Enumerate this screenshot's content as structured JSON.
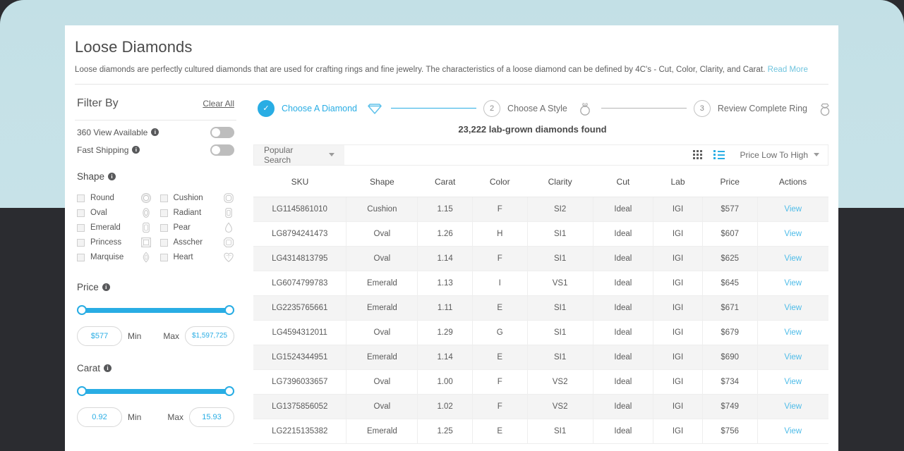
{
  "page": {
    "title": "Loose Diamonds",
    "description": "Loose diamonds are perfectly cultured diamonds that are used for crafting rings and fine jewelry. The characteristics of a loose diamond can be defined by 4C's - Cut, Color, Clarity, and Carat.",
    "read_more": "Read More"
  },
  "filter": {
    "title": "Filter By",
    "clear_all": "Clear All",
    "toggles": [
      {
        "label": "360 View Available",
        "info": "i",
        "state": "off"
      },
      {
        "label": "Fast Shipping",
        "info": "i",
        "state": "off"
      }
    ],
    "shape": {
      "title": "Shape",
      "info": "i",
      "items": [
        {
          "label": "Round",
          "icon": "round-shape-icon",
          "checked": false
        },
        {
          "label": "Cushion",
          "icon": "cushion-shape-icon",
          "checked": false
        },
        {
          "label": "Oval",
          "icon": "oval-shape-icon",
          "checked": false
        },
        {
          "label": "Radiant",
          "icon": "radiant-shape-icon",
          "checked": false
        },
        {
          "label": "Emerald",
          "icon": "emerald-shape-icon",
          "checked": false
        },
        {
          "label": "Pear",
          "icon": "pear-shape-icon",
          "checked": false
        },
        {
          "label": "Princess",
          "icon": "princess-shape-icon",
          "checked": false
        },
        {
          "label": "Asscher",
          "icon": "asscher-shape-icon",
          "checked": false
        },
        {
          "label": "Marquise",
          "icon": "marquise-shape-icon",
          "checked": false
        },
        {
          "label": "Heart",
          "icon": "heart-shape-icon",
          "checked": false
        }
      ]
    },
    "price": {
      "title": "Price",
      "info": "i",
      "min_value": "$577",
      "max_value": "$1,597,725",
      "min_label": "Min",
      "max_label": "Max"
    },
    "carat": {
      "title": "Carat",
      "info": "i",
      "min_value": "0.92",
      "max_value": "15.93",
      "min_label": "Min",
      "max_label": "Max"
    }
  },
  "stepper": {
    "steps": [
      {
        "num": "✓",
        "label": "Choose A Diamond",
        "icon": "diamond-icon",
        "state": "done"
      },
      {
        "num": "2",
        "label": "Choose A Style",
        "icon": "ring-icon",
        "state": "pending"
      },
      {
        "num": "3",
        "label": "Review Complete Ring",
        "icon": "ring-gem-icon",
        "state": "pending"
      }
    ]
  },
  "results": {
    "count_text": "23,222 lab-grown diamonds found"
  },
  "toolbar": {
    "popular_search": "Popular Search",
    "grid_view_icon": "grid-view-icon",
    "list_view_icon": "list-view-icon",
    "sort_value": "Price Low To High"
  },
  "table": {
    "columns": [
      "SKU",
      "Shape",
      "Carat",
      "Color",
      "Clarity",
      "Cut",
      "Lab",
      "Price",
      "Actions"
    ],
    "action_label": "View",
    "rows": [
      {
        "sku": "LG1145861010",
        "shape": "Cushion",
        "carat": "1.15",
        "color": "F",
        "clarity": "SI2",
        "cut": "Ideal",
        "lab": "IGI",
        "price": "$577",
        "action": "View"
      },
      {
        "sku": "LG8794241473",
        "shape": "Oval",
        "carat": "1.26",
        "color": "H",
        "clarity": "SI1",
        "cut": "Ideal",
        "lab": "IGI",
        "price": "$607",
        "action": "View"
      },
      {
        "sku": "LG4314813795",
        "shape": "Oval",
        "carat": "1.14",
        "color": "F",
        "clarity": "SI1",
        "cut": "Ideal",
        "lab": "IGI",
        "price": "$625",
        "action": "View"
      },
      {
        "sku": "LG6074799783",
        "shape": "Emerald",
        "carat": "1.13",
        "color": "I",
        "clarity": "VS1",
        "cut": "Ideal",
        "lab": "IGI",
        "price": "$645",
        "action": "View"
      },
      {
        "sku": "LG2235765661",
        "shape": "Emerald",
        "carat": "1.11",
        "color": "E",
        "clarity": "SI1",
        "cut": "Ideal",
        "lab": "IGI",
        "price": "$671",
        "action": "View"
      },
      {
        "sku": "LG4594312011",
        "shape": "Oval",
        "carat": "1.29",
        "color": "G",
        "clarity": "SI1",
        "cut": "Ideal",
        "lab": "IGI",
        "price": "$679",
        "action": "View"
      },
      {
        "sku": "LG1524344951",
        "shape": "Emerald",
        "carat": "1.14",
        "color": "E",
        "clarity": "SI1",
        "cut": "Ideal",
        "lab": "IGI",
        "price": "$690",
        "action": "View"
      },
      {
        "sku": "LG7396033657",
        "shape": "Oval",
        "carat": "1.00",
        "color": "F",
        "clarity": "VS2",
        "cut": "Ideal",
        "lab": "IGI",
        "price": "$734",
        "action": "View"
      },
      {
        "sku": "LG1375856052",
        "shape": "Oval",
        "carat": "1.02",
        "color": "F",
        "clarity": "VS2",
        "cut": "Ideal",
        "lab": "IGI",
        "price": "$749",
        "action": "View"
      },
      {
        "sku": "LG2215135382",
        "shape": "Emerald",
        "carat": "1.25",
        "color": "E",
        "clarity": "SI1",
        "cut": "Ideal",
        "lab": "IGI",
        "price": "$756",
        "action": "View"
      }
    ]
  },
  "colors": {
    "accent": "#29ade4",
    "link": "#4fbce8",
    "backdrop": "#c5e1e7",
    "page_bg": "#2b2c30"
  }
}
